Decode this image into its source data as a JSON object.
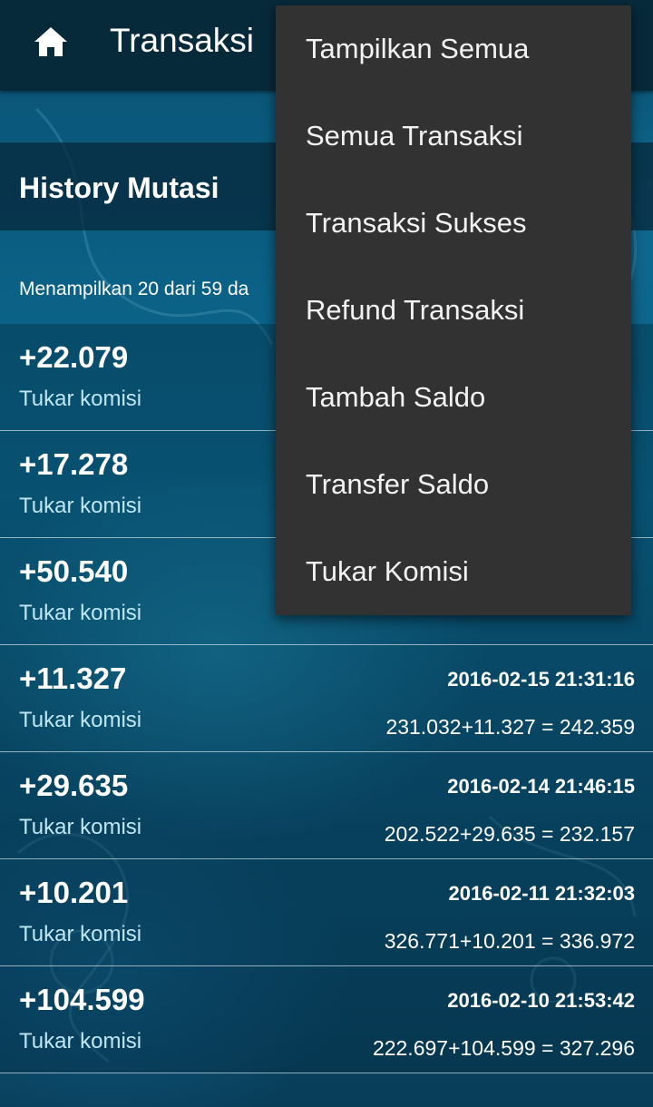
{
  "appbar": {
    "title": "Transaksi"
  },
  "section": {
    "title": "History Mutasi",
    "info": "Menampilkan 20 dari 59 da"
  },
  "transactions": [
    {
      "amount": "+22.079",
      "description": "Tukar komisi",
      "date": "",
      "calc": ""
    },
    {
      "amount": "+17.278",
      "description": "Tukar komisi",
      "date": "",
      "calc": ""
    },
    {
      "amount": "+50.540",
      "description": "Tukar komisi",
      "date": "",
      "calc": ""
    },
    {
      "amount": "+11.327",
      "description": "Tukar komisi",
      "date": "2016-02-15 21:31:16",
      "calc": "231.032+11.327 = 242.359"
    },
    {
      "amount": "+29.635",
      "description": "Tukar komisi",
      "date": "2016-02-14 21:46:15",
      "calc": "202.522+29.635 = 232.157"
    },
    {
      "amount": "+10.201",
      "description": "Tukar komisi",
      "date": "2016-02-11 21:32:03",
      "calc": "326.771+10.201 = 336.972"
    },
    {
      "amount": "+104.599",
      "description": "Tukar komisi",
      "date": "2016-02-10 21:53:42",
      "calc": "222.697+104.599 = 327.296"
    }
  ],
  "menu": {
    "items": [
      "Tampilkan Semua",
      "Semua Transaksi",
      "Transaksi Sukses",
      "Refund Transaksi",
      "Tambah Saldo",
      "Transfer Saldo",
      "Tukar Komisi"
    ]
  },
  "icons": {
    "home": "home-icon"
  },
  "colors": {
    "appbar": "#072a3b",
    "menu_bg": "#323232",
    "description_text": "#bfe6f4"
  }
}
